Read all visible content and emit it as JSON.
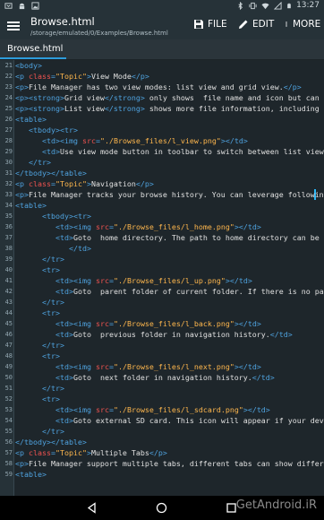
{
  "status_bar": {
    "time": "13:27",
    "left_icons": [
      "android-debug-icon",
      "android-icon",
      "image-icon"
    ],
    "right_icons": [
      "bluetooth-icon",
      "vibrate-icon",
      "wifi-icon",
      "no-sim-icon",
      "battery-icon"
    ]
  },
  "toolbar": {
    "title": "Browse.html",
    "path": "/storage/emulated/0/Examples/Browse.html",
    "file_label": "FILE",
    "edit_label": "EDIT",
    "more_label": "MORE"
  },
  "tabs": [
    {
      "label": "Browse.html",
      "active": true
    }
  ],
  "editor": {
    "lines": [
      {
        "n": "21",
        "indent": 0,
        "parts": [
          {
            "t": "tg",
            "s": "<body>"
          }
        ]
      },
      {
        "n": "22",
        "indent": 0,
        "parts": [
          {
            "t": "tg",
            "s": "<p "
          },
          {
            "t": "an",
            "s": "class"
          },
          {
            "t": "tg",
            "s": "="
          },
          {
            "t": "av",
            "s": "\"Topic\""
          },
          {
            "t": "tg",
            "s": ">"
          },
          {
            "t": "tx",
            "s": "View Mode"
          },
          {
            "t": "tg",
            "s": "</p>"
          }
        ]
      },
      {
        "n": "23",
        "indent": 0,
        "parts": [
          {
            "t": "tg",
            "s": "<p>"
          },
          {
            "t": "tx",
            "s": "File Manager has two view modes: list view and grid view."
          },
          {
            "t": "tg",
            "s": "</p>"
          }
        ]
      },
      {
        "n": "24",
        "indent": 0,
        "parts": [
          {
            "t": "tg",
            "s": "<p><strong>"
          },
          {
            "t": "tx",
            "s": "Grid view"
          },
          {
            "t": "tg",
            "s": "</strong>"
          },
          {
            "t": "tx",
            "s": " only shows  file name and icon but can display m"
          }
        ]
      },
      {
        "n": "25",
        "indent": 0,
        "parts": [
          {
            "t": "tg",
            "s": "<p><strong>"
          },
          {
            "t": "tx",
            "s": "List view"
          },
          {
            "t": "tg",
            "s": "</strong>"
          },
          {
            "t": "tx",
            "s": " shows more file information, including folder chil"
          }
        ]
      },
      {
        "n": "26",
        "indent": 0,
        "parts": [
          {
            "t": "tg",
            "s": "<table>"
          }
        ]
      },
      {
        "n": "27",
        "indent": 1,
        "parts": [
          {
            "t": "tg",
            "s": "<tbody><tr>"
          }
        ]
      },
      {
        "n": "28",
        "indent": 2,
        "parts": [
          {
            "t": "tg",
            "s": "<td><img "
          },
          {
            "t": "an",
            "s": "src"
          },
          {
            "t": "tg",
            "s": "="
          },
          {
            "t": "av",
            "s": "\"./Browse_files/l_view.png\""
          },
          {
            "t": "tg",
            "s": "></td>"
          }
        ]
      },
      {
        "n": "29",
        "indent": 2,
        "parts": [
          {
            "t": "tg",
            "s": "<td>"
          },
          {
            "t": "tx",
            "s": "Use view mode button in toolbar to switch between list view and grid vie"
          }
        ]
      },
      {
        "n": "30",
        "indent": 1,
        "parts": [
          {
            "t": "tg",
            "s": "</tr>"
          }
        ]
      },
      {
        "n": "31",
        "indent": 0,
        "parts": [
          {
            "t": "tg",
            "s": "</tbody></table>"
          }
        ]
      },
      {
        "n": "32",
        "indent": 0,
        "parts": [
          {
            "t": "tg",
            "s": "<p "
          },
          {
            "t": "an",
            "s": "class"
          },
          {
            "t": "tg",
            "s": "="
          },
          {
            "t": "av",
            "s": "\"Topic\""
          },
          {
            "t": "tg",
            "s": ">"
          },
          {
            "t": "tx",
            "s": "Navigation"
          },
          {
            "t": "tg",
            "s": "</p>"
          }
        ]
      },
      {
        "n": "33",
        "indent": 0,
        "parts": [
          {
            "t": "tg",
            "s": "<p>"
          },
          {
            "t": "tx",
            "s": "File Manager tracks your browse history. You can leverage following navigati"
          }
        ]
      },
      {
        "n": "34",
        "indent": 0,
        "parts": [
          {
            "t": "tg",
            "s": "<table>"
          }
        ]
      },
      {
        "n": "35",
        "indent": 2,
        "parts": [
          {
            "t": "tg",
            "s": "<tbody><tr>"
          }
        ]
      },
      {
        "n": "36",
        "indent": 3,
        "parts": [
          {
            "t": "tg",
            "s": "<td><img "
          },
          {
            "t": "an",
            "s": "src"
          },
          {
            "t": "tg",
            "s": "="
          },
          {
            "t": "av",
            "s": "\"./Browse_files/l_home.png\""
          },
          {
            "t": "tg",
            "s": "></td>"
          }
        ]
      },
      {
        "n": "37",
        "indent": 3,
        "parts": [
          {
            "t": "tg",
            "s": "<td>"
          },
          {
            "t": "tx",
            "s": "Goto  home directory. The path to home directory can be customized"
          }
        ]
      },
      {
        "n": "38",
        "indent": 4,
        "parts": [
          {
            "t": "tg",
            "s": "</td>"
          }
        ]
      },
      {
        "n": "39",
        "indent": 2,
        "parts": [
          {
            "t": "tg",
            "s": "</tr>"
          }
        ]
      },
      {
        "n": "40",
        "indent": 2,
        "parts": [
          {
            "t": "tg",
            "s": "<tr>"
          }
        ]
      },
      {
        "n": "41",
        "indent": 3,
        "parts": [
          {
            "t": "tg",
            "s": "<td><img "
          },
          {
            "t": "an",
            "s": "src"
          },
          {
            "t": "tg",
            "s": "="
          },
          {
            "t": "av",
            "s": "\"./Browse_files/l_up.png\""
          },
          {
            "t": "tg",
            "s": "></td>"
          }
        ]
      },
      {
        "n": "42",
        "indent": 3,
        "parts": [
          {
            "t": "tg",
            "s": "<td>"
          },
          {
            "t": "tx",
            "s": "Goto  parent folder of current folder. If there is no parent folder availab"
          }
        ]
      },
      {
        "n": "43",
        "indent": 2,
        "parts": [
          {
            "t": "tg",
            "s": "</tr>"
          }
        ]
      },
      {
        "n": "44",
        "indent": 2,
        "parts": [
          {
            "t": "tg",
            "s": "<tr>"
          }
        ]
      },
      {
        "n": "45",
        "indent": 3,
        "parts": [
          {
            "t": "tg",
            "s": "<td><img "
          },
          {
            "t": "an",
            "s": "src"
          },
          {
            "t": "tg",
            "s": "="
          },
          {
            "t": "av",
            "s": "\"./Browse_files/l_back.png\""
          },
          {
            "t": "tg",
            "s": "></td>"
          }
        ]
      },
      {
        "n": "46",
        "indent": 3,
        "parts": [
          {
            "t": "tg",
            "s": "<td>"
          },
          {
            "t": "tx",
            "s": "Goto  previous folder in navigation history."
          },
          {
            "t": "tg",
            "s": "</td>"
          }
        ]
      },
      {
        "n": "47",
        "indent": 2,
        "parts": [
          {
            "t": "tg",
            "s": "</tr>"
          }
        ]
      },
      {
        "n": "48",
        "indent": 2,
        "parts": [
          {
            "t": "tg",
            "s": "<tr>"
          }
        ]
      },
      {
        "n": "49",
        "indent": 3,
        "parts": [
          {
            "t": "tg",
            "s": "<td><img "
          },
          {
            "t": "an",
            "s": "src"
          },
          {
            "t": "tg",
            "s": "="
          },
          {
            "t": "av",
            "s": "\"./Browse_files/l_next.png\""
          },
          {
            "t": "tg",
            "s": "></td>"
          }
        ]
      },
      {
        "n": "50",
        "indent": 3,
        "parts": [
          {
            "t": "tg",
            "s": "<td>"
          },
          {
            "t": "tx",
            "s": "Goto  next folder in navigation history."
          },
          {
            "t": "tg",
            "s": "</td>"
          }
        ]
      },
      {
        "n": "51",
        "indent": 2,
        "parts": [
          {
            "t": "tg",
            "s": "</tr>"
          }
        ]
      },
      {
        "n": "52",
        "indent": 2,
        "parts": [
          {
            "t": "tg",
            "s": "<tr>"
          }
        ]
      },
      {
        "n": "53",
        "indent": 3,
        "parts": [
          {
            "t": "tg",
            "s": "<td><img "
          },
          {
            "t": "an",
            "s": "src"
          },
          {
            "t": "tg",
            "s": "="
          },
          {
            "t": "av",
            "s": "\"./Browse_files/l_sdcard.png\""
          },
          {
            "t": "tg",
            "s": "></td>"
          }
        ]
      },
      {
        "n": "54",
        "indent": 3,
        "parts": [
          {
            "t": "tg",
            "s": "<td>"
          },
          {
            "t": "tx",
            "s": "Goto external SD card. This icon will appear if your device uses a parti"
          }
        ]
      },
      {
        "n": "55",
        "indent": 2,
        "parts": [
          {
            "t": "tg",
            "s": "</tr>"
          }
        ]
      },
      {
        "n": "56",
        "indent": 0,
        "parts": [
          {
            "t": "tg",
            "s": "</tbody></table>"
          }
        ]
      },
      {
        "n": "57",
        "indent": 0,
        "parts": [
          {
            "t": "tg",
            "s": "<p "
          },
          {
            "t": "an",
            "s": "class"
          },
          {
            "t": "tg",
            "s": "="
          },
          {
            "t": "av",
            "s": "\"Topic\""
          },
          {
            "t": "tg",
            "s": ">"
          },
          {
            "t": "tx",
            "s": "Multiple Tabs"
          },
          {
            "t": "tg",
            "s": "</p>"
          }
        ]
      },
      {
        "n": "58",
        "indent": 0,
        "parts": [
          {
            "t": "tg",
            "s": "<p>"
          },
          {
            "t": "tx",
            "s": "File Manager support multiple tabs, different tabs can show different folder in"
          }
        ]
      },
      {
        "n": "59",
        "indent": 0,
        "parts": [
          {
            "t": "tg",
            "s": "<table>"
          }
        ]
      }
    ]
  },
  "nav_bar": {
    "icons": [
      "back-icon",
      "home-icon",
      "recents-icon"
    ],
    "watermark": "GetAndroid.iR"
  },
  "colors": {
    "background": "#263238",
    "editor_bg": "#1e262b",
    "tag": "#4fa3e0",
    "attr_name": "#ef5350",
    "attr_value": "#ffb74d",
    "text": "#e0e0e0",
    "accent": "#2d9cdb"
  }
}
